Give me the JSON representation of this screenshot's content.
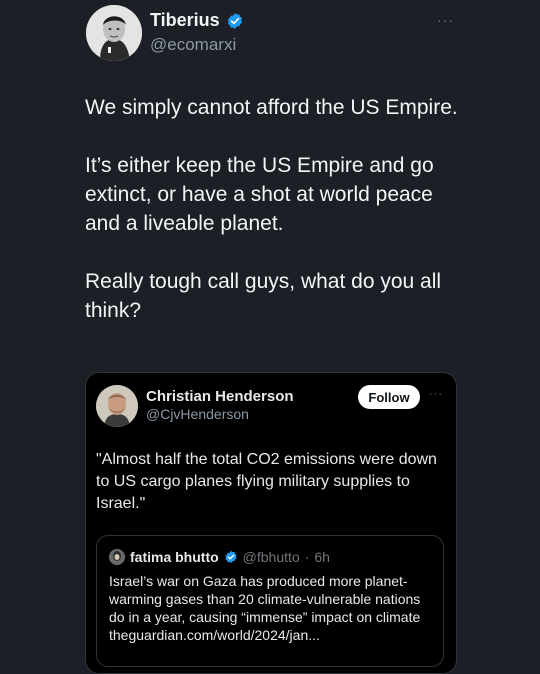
{
  "tweet": {
    "author_name": "Tiberius",
    "author_handle": "@ecomarxi",
    "more_label": "···",
    "paragraphs": [
      "We simply cannot afford the US Empire.",
      "It’s either keep the US Empire and go extinct, or have a shot at world peace and a liveable planet.",
      "Really tough call guys, what do you all think?"
    ]
  },
  "quote": {
    "author_name": "Christian Henderson",
    "author_handle": "@CjvHenderson",
    "follow_label": "Follow",
    "more_label": "···",
    "text": "\"Almost half the total CO2 emissions were down to US cargo planes flying military supplies to Israel.\"",
    "inner": {
      "author_name": "fatima bhutto",
      "author_handle": "@fbhutto",
      "time": "6h",
      "text": "Israel’s war on Gaza has produced more planet-warming gases than 20 climate-vulnerable nations do in a year, causing “immense” impact on climate theguardian.com/world/2024/jan..."
    }
  },
  "icons": {
    "verified": "verified-badge-icon",
    "more": "more-options-icon"
  },
  "colors": {
    "background": "#1c1f26",
    "card": "#000000",
    "verified_blue": "#1d9bf0",
    "secondary_text": "#8b98a5"
  }
}
